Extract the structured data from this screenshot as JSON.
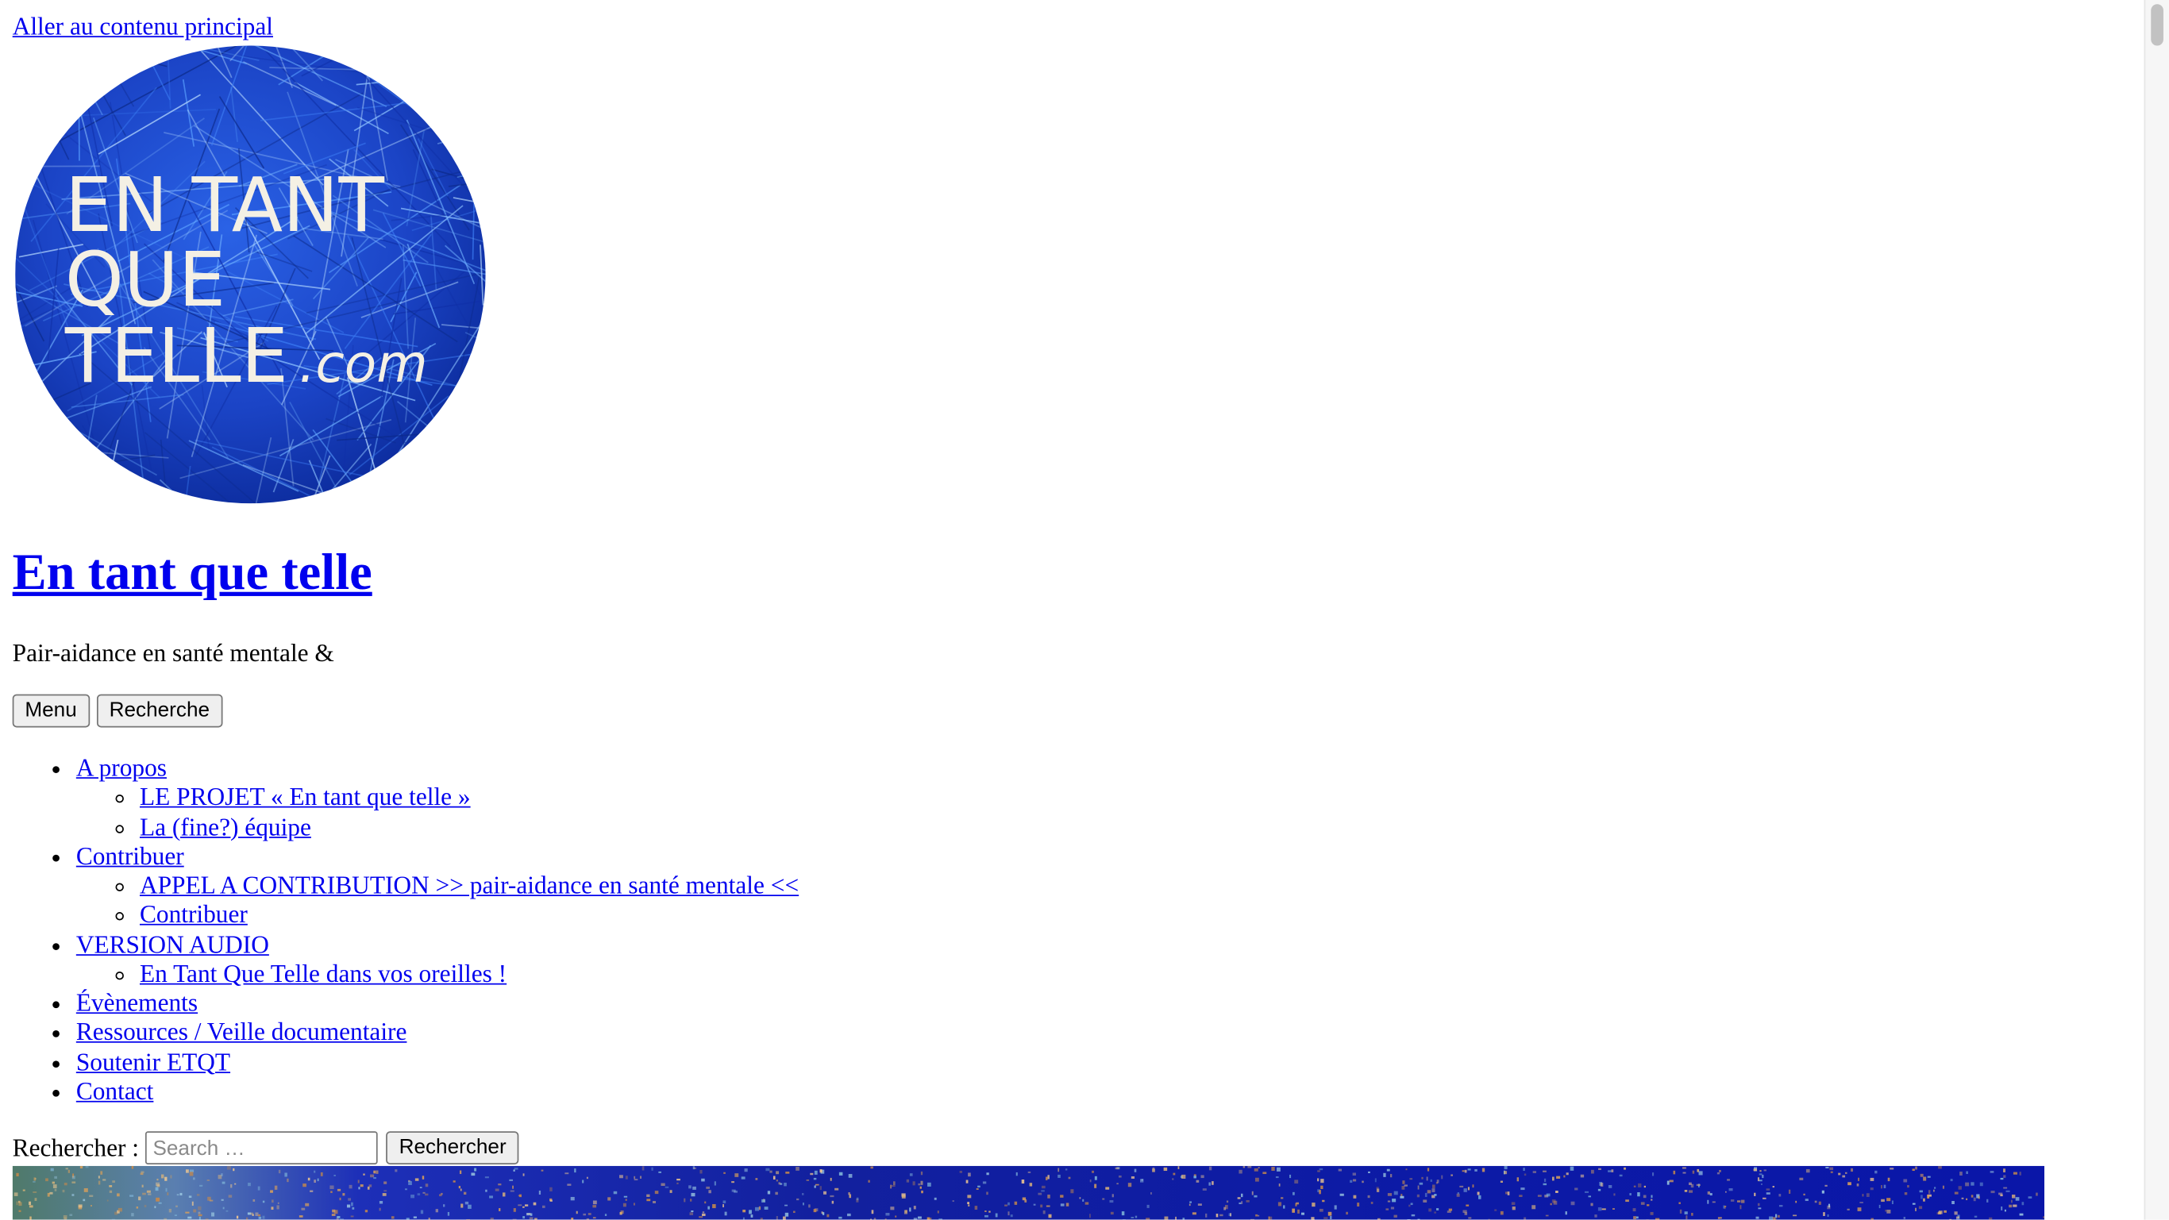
{
  "skip_link": "Aller au contenu principal",
  "logo": {
    "lines": [
      "EN TANT",
      "QUE",
      "TELLE"
    ],
    "suffix": ".com"
  },
  "site": {
    "title": "En tant que telle",
    "description": "Pair-aidance en santé mentale &"
  },
  "buttons": {
    "menu": "Menu",
    "search_toggle": "Recherche"
  },
  "menu": [
    {
      "label": "A propos",
      "children": [
        "LE PROJET « En tant que telle »",
        "La (fine?) équipe"
      ]
    },
    {
      "label": "Contribuer",
      "children": [
        "APPEL A CONTRIBUTION >> pair-aidance en santé mentale <<",
        "Contribuer"
      ]
    },
    {
      "label": "VERSION AUDIO",
      "children": [
        "En Tant Que Telle dans vos oreilles !"
      ]
    },
    {
      "label": "Évènements",
      "children": []
    },
    {
      "label": "Ressources / Veille documentaire",
      "children": []
    },
    {
      "label": "Soutenir ETQT",
      "children": []
    },
    {
      "label": "Contact",
      "children": []
    }
  ],
  "search": {
    "label": "Rechercher :",
    "placeholder": "Search …",
    "submit": "Rechercher"
  },
  "colors": {
    "link": "#0000ee",
    "logo_blue": "#1a45c8",
    "logo_text": "#f4f0e4",
    "header_image_blue": "#0a1aa0"
  }
}
